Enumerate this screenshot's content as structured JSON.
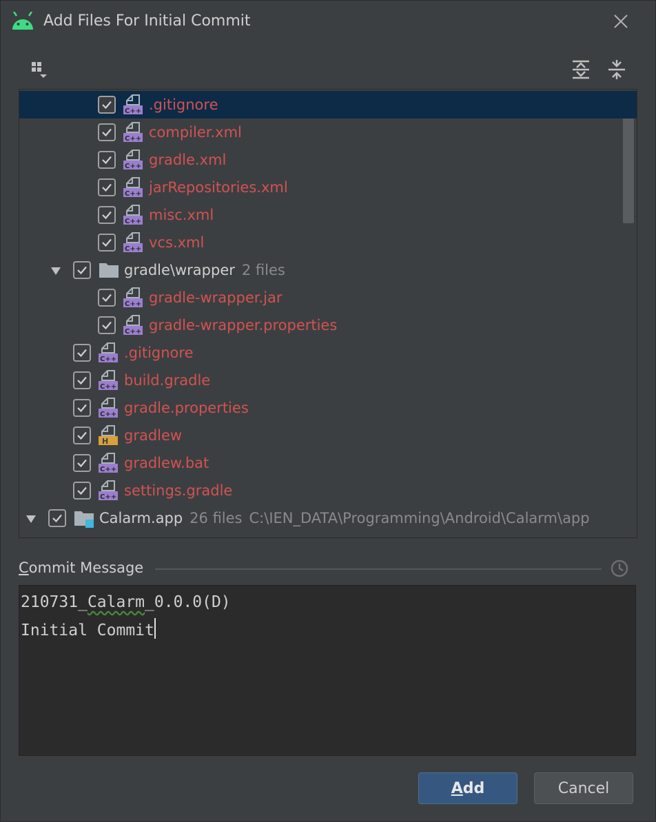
{
  "dialog": {
    "title": "Add Files For Initial Commit",
    "icon": "android-icon"
  },
  "toolbar": {
    "group_by": "group-by-icon",
    "expand_all": "expand-all-icon",
    "collapse_all": "collapse-all-icon"
  },
  "tree": {
    "rows": [
      {
        "label": ".gitignore",
        "meta": "",
        "path": "",
        "icon": "file-cpp",
        "checked": true,
        "selected": true,
        "expanded": null,
        "depth": 2,
        "style": "unversioned"
      },
      {
        "label": "compiler.xml",
        "meta": "",
        "path": "",
        "icon": "file-cpp",
        "checked": true,
        "selected": false,
        "expanded": null,
        "depth": 2,
        "style": "unversioned"
      },
      {
        "label": "gradle.xml",
        "meta": "",
        "path": "",
        "icon": "file-cpp",
        "checked": true,
        "selected": false,
        "expanded": null,
        "depth": 2,
        "style": "unversioned"
      },
      {
        "label": "jarRepositories.xml",
        "meta": "",
        "path": "",
        "icon": "file-cpp",
        "checked": true,
        "selected": false,
        "expanded": null,
        "depth": 2,
        "style": "unversioned"
      },
      {
        "label": "misc.xml",
        "meta": "",
        "path": "",
        "icon": "file-cpp",
        "checked": true,
        "selected": false,
        "expanded": null,
        "depth": 2,
        "style": "unversioned"
      },
      {
        "label": "vcs.xml",
        "meta": "",
        "path": "",
        "icon": "file-cpp",
        "checked": true,
        "selected": false,
        "expanded": null,
        "depth": 2,
        "style": "unversioned"
      },
      {
        "label": "gradle\\wrapper",
        "meta": "2 files",
        "path": "",
        "icon": "folder",
        "checked": true,
        "selected": false,
        "expanded": true,
        "depth": 1,
        "style": "normal"
      },
      {
        "label": "gradle-wrapper.jar",
        "meta": "",
        "path": "",
        "icon": "file-cpp",
        "checked": true,
        "selected": false,
        "expanded": null,
        "depth": 2,
        "style": "unversioned"
      },
      {
        "label": "gradle-wrapper.properties",
        "meta": "",
        "path": "",
        "icon": "file-cpp",
        "checked": true,
        "selected": false,
        "expanded": null,
        "depth": 2,
        "style": "unversioned"
      },
      {
        "label": ".gitignore",
        "meta": "",
        "path": "",
        "icon": "file-cpp",
        "checked": true,
        "selected": false,
        "expanded": null,
        "depth": 1,
        "style": "unversioned"
      },
      {
        "label": "build.gradle",
        "meta": "",
        "path": "",
        "icon": "file-cpp",
        "checked": true,
        "selected": false,
        "expanded": null,
        "depth": 1,
        "style": "unversioned"
      },
      {
        "label": "gradle.properties",
        "meta": "",
        "path": "",
        "icon": "file-cpp",
        "checked": true,
        "selected": false,
        "expanded": null,
        "depth": 1,
        "style": "unversioned"
      },
      {
        "label": "gradlew",
        "meta": "",
        "path": "",
        "icon": "file-h",
        "checked": true,
        "selected": false,
        "expanded": null,
        "depth": 1,
        "style": "unversioned"
      },
      {
        "label": "gradlew.bat",
        "meta": "",
        "path": "",
        "icon": "file-cpp",
        "checked": true,
        "selected": false,
        "expanded": null,
        "depth": 1,
        "style": "unversioned"
      },
      {
        "label": "settings.gradle",
        "meta": "",
        "path": "",
        "icon": "file-cpp",
        "checked": true,
        "selected": false,
        "expanded": null,
        "depth": 1,
        "style": "unversioned"
      },
      {
        "label": "Calarm.app",
        "meta": "26 files",
        "path": "C:\\IEN_DATA\\Programming\\Android\\Calarm\\app",
        "icon": "module-folder",
        "checked": true,
        "selected": false,
        "expanded": true,
        "depth": 0,
        "style": "normal"
      }
    ]
  },
  "commit": {
    "label_mnemonic": "C",
    "label_rest": "ommit Message",
    "message_line1_prefix": "210731_",
    "message_line1_word": "Calarm",
    "message_line1_suffix": "_0.0.0(D)",
    "message_line2": "Initial Commit"
  },
  "buttons": {
    "add_mnemonic": "A",
    "add_rest": "dd",
    "cancel": "Cancel"
  },
  "colors": {
    "background": "#3c3f41",
    "selection": "#0d2b46",
    "unversioned_text": "#d25252",
    "primary_button": "#365880",
    "cpp_badge": "#9b7fcf",
    "h_badge": "#d8a13a"
  }
}
